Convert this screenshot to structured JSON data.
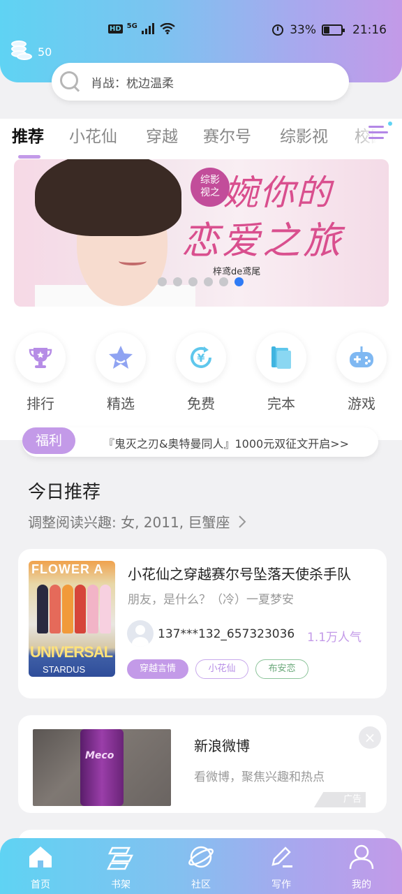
{
  "status_bar": {
    "network": "5G",
    "hd": "HD",
    "battery_text": "33%",
    "battery_level": 0.33,
    "time": "21:16"
  },
  "coins": {
    "icon": "coins-icon",
    "count": "50"
  },
  "search": {
    "icon": "search-icon",
    "placeholder": "肖战：枕边温柔"
  },
  "tabs": [
    {
      "label": "推荐",
      "active": true
    },
    {
      "label": "小花仙"
    },
    {
      "label": "穿越"
    },
    {
      "label": "赛尔号"
    },
    {
      "label": "综影视"
    },
    {
      "label": "校园"
    }
  ],
  "banner": {
    "badge": "综影\n视之",
    "title_line1": "婉你的",
    "title_line2": "恋爱之旅",
    "author": "梓鸢de鸢尾",
    "slides_total": 6,
    "active_slide": 6
  },
  "categories": [
    {
      "label": "排行",
      "icon": "trophy-icon"
    },
    {
      "label": "精选",
      "icon": "star-icon"
    },
    {
      "label": "免费",
      "icon": "yen-refresh-icon"
    },
    {
      "label": "完本",
      "icon": "book-icon"
    },
    {
      "label": "游戏",
      "icon": "gamepad-icon"
    }
  ],
  "notice": {
    "badge": "福利",
    "text": "『鬼灭之刃&奥特曼同人』1000元双征文开启>>"
  },
  "today": {
    "title": "今日推荐",
    "subtitle": "调整阅读兴趣: 女, 2011, 巨蟹座"
  },
  "book": {
    "cover_text_top": "FLOWER A",
    "cover_text_mid": "UNIVERSAL",
    "cover_text_bottom": "STARDUS",
    "title": "小花仙之穿越赛尔号坠落天使杀手队",
    "author": "朋友，是什么？（冷）一夏梦安",
    "user_id": "137***132_657323036",
    "popularity": "1.1万人气",
    "tags": [
      "穿越言情",
      "小花仙",
      "布安恋"
    ]
  },
  "ad": {
    "title": "新浪微博",
    "description": "看微博，聚焦兴趣和热点",
    "label": "广告",
    "image_text": "Meco"
  },
  "bottom_nav": [
    {
      "label": "首页",
      "icon": "home-icon",
      "active": true
    },
    {
      "label": "书架",
      "icon": "bookshelf-icon"
    },
    {
      "label": "社区",
      "icon": "planet-icon"
    },
    {
      "label": "写作",
      "icon": "pen-icon"
    },
    {
      "label": "我的",
      "icon": "profile-icon"
    }
  ],
  "colors": {
    "accent": "#c39ae8",
    "header_start": "#5fd3f3",
    "header_end": "#c39ae8",
    "dot_active": "#2f7bf5",
    "tag_green": "#7ab88a"
  }
}
